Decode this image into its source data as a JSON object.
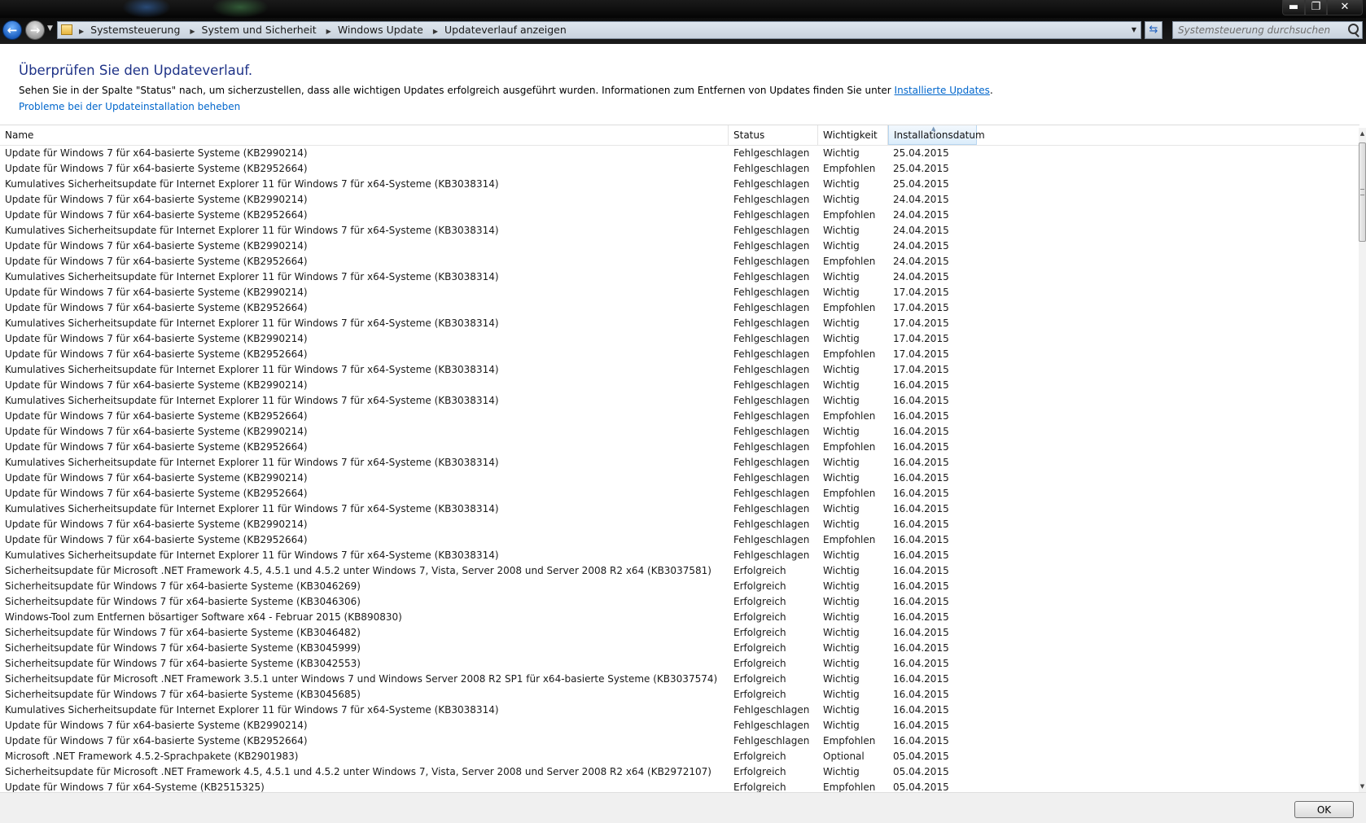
{
  "window": {
    "minimize": "▬",
    "maximize": "❐",
    "close": "✕"
  },
  "nav": {
    "back": "←",
    "forward": "→",
    "breadcrumbs": [
      "Systemsteuerung",
      "System und Sicherheit",
      "Windows Update",
      "Updateverlauf anzeigen"
    ],
    "search_placeholder": "Systemsteuerung durchsuchen"
  },
  "page": {
    "title": "Überprüfen Sie den Updateverlauf.",
    "description": "Sehen Sie in der Spalte \"Status\" nach, um sicherzustellen, dass alle wichtigen Updates erfolgreich ausgeführt wurden. Informationen zum Entfernen von Updates finden Sie unter ",
    "installed_link": "Installierte Updates",
    "description_end": ".",
    "troubleshoot_link": "Probleme bei der Updateinstallation beheben"
  },
  "table": {
    "columns": {
      "name": "Name",
      "status": "Status",
      "importance": "Wichtigkeit",
      "date": "Installationsdatum"
    },
    "rows": [
      [
        "Update für Windows 7 für x64-basierte Systeme (KB2990214)",
        "Fehlgeschlagen",
        "Wichtig",
        "25.04.2015"
      ],
      [
        "Update für Windows 7 für x64-basierte Systeme (KB2952664)",
        "Fehlgeschlagen",
        "Empfohlen",
        "25.04.2015"
      ],
      [
        "Kumulatives Sicherheitsupdate für Internet Explorer 11 für Windows 7 für x64-Systeme (KB3038314)",
        "Fehlgeschlagen",
        "Wichtig",
        "25.04.2015"
      ],
      [
        "Update für Windows 7 für x64-basierte Systeme (KB2990214)",
        "Fehlgeschlagen",
        "Wichtig",
        "24.04.2015"
      ],
      [
        "Update für Windows 7 für x64-basierte Systeme (KB2952664)",
        "Fehlgeschlagen",
        "Empfohlen",
        "24.04.2015"
      ],
      [
        "Kumulatives Sicherheitsupdate für Internet Explorer 11 für Windows 7 für x64-Systeme (KB3038314)",
        "Fehlgeschlagen",
        "Wichtig",
        "24.04.2015"
      ],
      [
        "Update für Windows 7 für x64-basierte Systeme (KB2990214)",
        "Fehlgeschlagen",
        "Wichtig",
        "24.04.2015"
      ],
      [
        "Update für Windows 7 für x64-basierte Systeme (KB2952664)",
        "Fehlgeschlagen",
        "Empfohlen",
        "24.04.2015"
      ],
      [
        "Kumulatives Sicherheitsupdate für Internet Explorer 11 für Windows 7 für x64-Systeme (KB3038314)",
        "Fehlgeschlagen",
        "Wichtig",
        "24.04.2015"
      ],
      [
        "Update für Windows 7 für x64-basierte Systeme (KB2990214)",
        "Fehlgeschlagen",
        "Wichtig",
        "17.04.2015"
      ],
      [
        "Update für Windows 7 für x64-basierte Systeme (KB2952664)",
        "Fehlgeschlagen",
        "Empfohlen",
        "17.04.2015"
      ],
      [
        "Kumulatives Sicherheitsupdate für Internet Explorer 11 für Windows 7 für x64-Systeme (KB3038314)",
        "Fehlgeschlagen",
        "Wichtig",
        "17.04.2015"
      ],
      [
        "Update für Windows 7 für x64-basierte Systeme (KB2990214)",
        "Fehlgeschlagen",
        "Wichtig",
        "17.04.2015"
      ],
      [
        "Update für Windows 7 für x64-basierte Systeme (KB2952664)",
        "Fehlgeschlagen",
        "Empfohlen",
        "17.04.2015"
      ],
      [
        "Kumulatives Sicherheitsupdate für Internet Explorer 11 für Windows 7 für x64-Systeme (KB3038314)",
        "Fehlgeschlagen",
        "Wichtig",
        "17.04.2015"
      ],
      [
        "Update für Windows 7 für x64-basierte Systeme (KB2990214)",
        "Fehlgeschlagen",
        "Wichtig",
        "16.04.2015"
      ],
      [
        "Kumulatives Sicherheitsupdate für Internet Explorer 11 für Windows 7 für x64-Systeme (KB3038314)",
        "Fehlgeschlagen",
        "Wichtig",
        "16.04.2015"
      ],
      [
        "Update für Windows 7 für x64-basierte Systeme (KB2952664)",
        "Fehlgeschlagen",
        "Empfohlen",
        "16.04.2015"
      ],
      [
        "Update für Windows 7 für x64-basierte Systeme (KB2990214)",
        "Fehlgeschlagen",
        "Wichtig",
        "16.04.2015"
      ],
      [
        "Update für Windows 7 für x64-basierte Systeme (KB2952664)",
        "Fehlgeschlagen",
        "Empfohlen",
        "16.04.2015"
      ],
      [
        "Kumulatives Sicherheitsupdate für Internet Explorer 11 für Windows 7 für x64-Systeme (KB3038314)",
        "Fehlgeschlagen",
        "Wichtig",
        "16.04.2015"
      ],
      [
        "Update für Windows 7 für x64-basierte Systeme (KB2990214)",
        "Fehlgeschlagen",
        "Wichtig",
        "16.04.2015"
      ],
      [
        "Update für Windows 7 für x64-basierte Systeme (KB2952664)",
        "Fehlgeschlagen",
        "Empfohlen",
        "16.04.2015"
      ],
      [
        "Kumulatives Sicherheitsupdate für Internet Explorer 11 für Windows 7 für x64-Systeme (KB3038314)",
        "Fehlgeschlagen",
        "Wichtig",
        "16.04.2015"
      ],
      [
        "Update für Windows 7 für x64-basierte Systeme (KB2990214)",
        "Fehlgeschlagen",
        "Wichtig",
        "16.04.2015"
      ],
      [
        "Update für Windows 7 für x64-basierte Systeme (KB2952664)",
        "Fehlgeschlagen",
        "Empfohlen",
        "16.04.2015"
      ],
      [
        "Kumulatives Sicherheitsupdate für Internet Explorer 11 für Windows 7 für x64-Systeme (KB3038314)",
        "Fehlgeschlagen",
        "Wichtig",
        "16.04.2015"
      ],
      [
        "Sicherheitsupdate für Microsoft .NET Framework 4.5, 4.5.1 und 4.5.2 unter Windows 7, Vista, Server 2008 und Server 2008 R2 x64 (KB3037581)",
        "Erfolgreich",
        "Wichtig",
        "16.04.2015"
      ],
      [
        "Sicherheitsupdate für Windows 7 für x64-basierte Systeme (KB3046269)",
        "Erfolgreich",
        "Wichtig",
        "16.04.2015"
      ],
      [
        "Sicherheitsupdate für Windows 7 für x64-basierte Systeme (KB3046306)",
        "Erfolgreich",
        "Wichtig",
        "16.04.2015"
      ],
      [
        "Windows-Tool zum Entfernen bösartiger Software x64 - Februar 2015 (KB890830)",
        "Erfolgreich",
        "Wichtig",
        "16.04.2015"
      ],
      [
        "Sicherheitsupdate für Windows 7 für x64-basierte Systeme (KB3046482)",
        "Erfolgreich",
        "Wichtig",
        "16.04.2015"
      ],
      [
        "Sicherheitsupdate für Windows 7 für x64-basierte Systeme (KB3045999)",
        "Erfolgreich",
        "Wichtig",
        "16.04.2015"
      ],
      [
        "Sicherheitsupdate für Windows 7 für x64-basierte Systeme (KB3042553)",
        "Erfolgreich",
        "Wichtig",
        "16.04.2015"
      ],
      [
        "Sicherheitsupdate für Microsoft .NET Framework 3.5.1 unter Windows 7 und Windows Server 2008 R2 SP1 für x64-basierte Systeme (KB3037574)",
        "Erfolgreich",
        "Wichtig",
        "16.04.2015"
      ],
      [
        "Sicherheitsupdate für Windows 7 für x64-basierte Systeme (KB3045685)",
        "Erfolgreich",
        "Wichtig",
        "16.04.2015"
      ],
      [
        "Kumulatives Sicherheitsupdate für Internet Explorer 11 für Windows 7 für x64-Systeme (KB3038314)",
        "Fehlgeschlagen",
        "Wichtig",
        "16.04.2015"
      ],
      [
        "Update für Windows 7 für x64-basierte Systeme (KB2990214)",
        "Fehlgeschlagen",
        "Wichtig",
        "16.04.2015"
      ],
      [
        "Update für Windows 7 für x64-basierte Systeme (KB2952664)",
        "Fehlgeschlagen",
        "Empfohlen",
        "16.04.2015"
      ],
      [
        "Microsoft .NET Framework 4.5.2-Sprachpakete (KB2901983)",
        "Erfolgreich",
        "Optional",
        "05.04.2015"
      ],
      [
        "Sicherheitsupdate für Microsoft .NET Framework 4.5, 4.5.1 und 4.5.2 unter Windows 7, Vista, Server 2008 und Server 2008 R2 x64 (KB2972107)",
        "Erfolgreich",
        "Wichtig",
        "05.04.2015"
      ],
      [
        "Update für Windows 7 für x64-Systeme (KB2515325)",
        "Erfolgreich",
        "Empfohlen",
        "05.04.2015"
      ]
    ]
  },
  "footer": {
    "ok_label": "OK"
  }
}
